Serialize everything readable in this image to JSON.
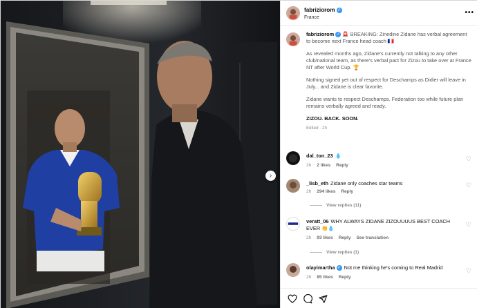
{
  "post": {
    "username": "fabriziorom",
    "location": "France",
    "caption_lines": [
      "🚨 BREAKING: Zinedine Zidane has verbal agreement to become next France head coach 🇫🇷",
      "As revealed months ago, Zidane's currently not talking to any other club/national team, as there's verbal pact for Zizou to take over at France NT after World Cup. 🏆",
      "Nothing signed yet out of respect for Deschamps as Didier will leave in July... and Zidane is clear favorite.",
      "Zidane wants to respect Deschamps. Federation too while future plan remains verbally agreed and ready.",
      "ZIZOU. BACK. SOON."
    ],
    "edited": "Edited · 2h"
  },
  "comments": [
    {
      "username": "dal_ton_23",
      "text": "💧",
      "time": "2h",
      "likes": "2 likes",
      "reply": "Reply"
    },
    {
      "username": "_lisb_eth",
      "text": "Zidane only coaches star teams",
      "time": "2h",
      "likes": "294 likes",
      "reply": "Reply",
      "view_replies": "View replies (11)"
    },
    {
      "username": "veratt_06",
      "text": "WHY ALWAYS ZIDANE ZIZOUUUUS BEST COACH EVER 👏💧",
      "time": "2h",
      "likes": "93 likes",
      "reply": "Reply",
      "see_translation": "See translation",
      "view_replies": "View replies (1)"
    },
    {
      "username": "olayimartha",
      "text": "Not me thinking he's coming to Real Madrid",
      "time": "2h",
      "likes": "85 likes",
      "reply": "Reply"
    }
  ],
  "icons": [
    "heart-icon",
    "comment-icon",
    "share-icon",
    "next-arrow-icon",
    "more-icon",
    "verified-icon"
  ],
  "colors": {
    "verified": "#3897f0",
    "background": "#ffffff",
    "media_bg": "#1c1e22"
  }
}
